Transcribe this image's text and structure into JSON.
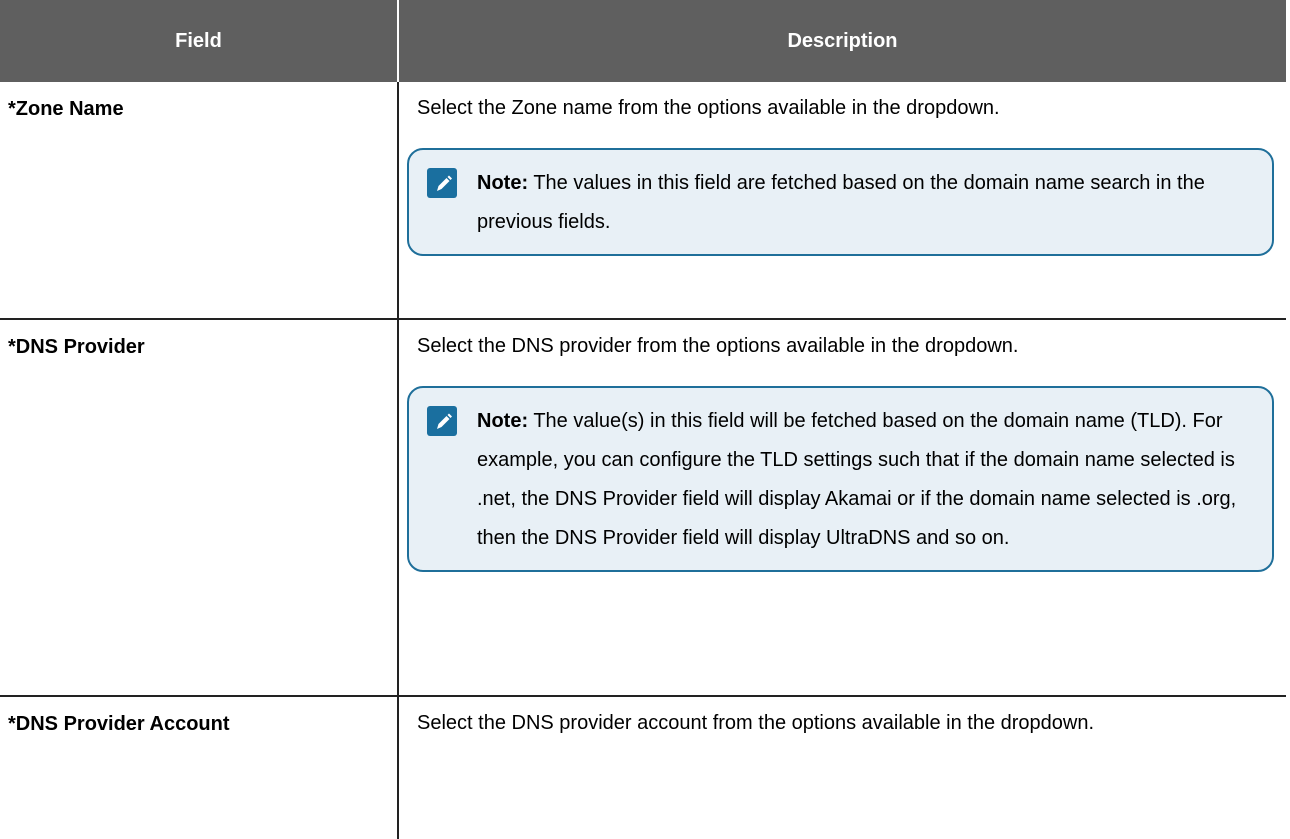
{
  "table": {
    "headers": {
      "field": "Field",
      "description": "Description"
    },
    "rows": [
      {
        "field": "*Zone Name",
        "description": "Select the Zone name from the options available in the dropdown.",
        "note_label": "Note:",
        "note_text": "The values in this field are fetched based on the domain name search in the previous fields."
      },
      {
        "field": "*DNS Provider",
        "description": "Select the DNS provider from the options available in the dropdown.",
        "note_label": "Note:",
        "note_text": "The value(s) in this field will be fetched based on the domain name (TLD). For example, you can configure the TLD settings such that if the domain name selected is .net, the DNS Provider field will display Akamai or if the domain name selected is .org, then the DNS Provider field will display UltraDNS and so on."
      },
      {
        "field": "*DNS Provider Account",
        "description": "Select the DNS provider account from the options available in the dropdown."
      }
    ]
  },
  "icons": {
    "note": "pencil-icon"
  },
  "colors": {
    "header_bg": "#5f5f5f",
    "note_border": "#1f6f9a",
    "note_bg": "#e8f0f6",
    "icon_bg": "#1a6f9f"
  }
}
